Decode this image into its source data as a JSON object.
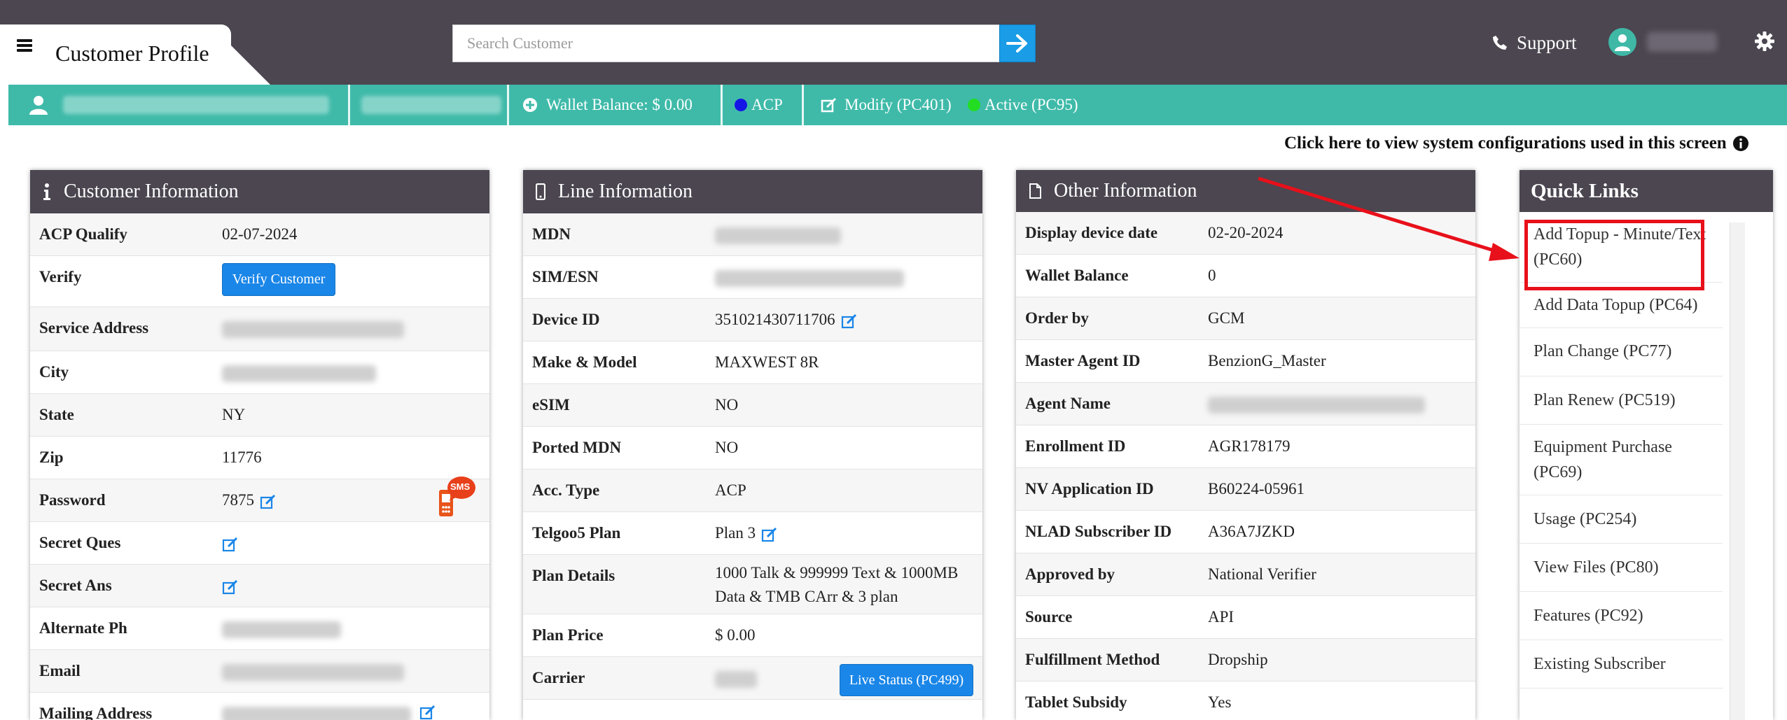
{
  "header": {
    "title": "Customer Profile",
    "search_placeholder": "Search Customer",
    "support_label": "Support"
  },
  "status_bar": {
    "wallet": "Wallet Balance: $ 0.00",
    "program": "ACP",
    "modify": "Modify (PC401)",
    "active": "Active (PC95)",
    "colors": {
      "program_dot": "#1515e6",
      "active_dot": "#22dd22"
    }
  },
  "config_link": "Click here to view system configurations used in this screen",
  "customer_info": {
    "title": "Customer Information",
    "verify_button": "Verify Customer",
    "rows": [
      {
        "label": "ACP Qualify",
        "value": "02-07-2024"
      },
      {
        "label": "Verify",
        "value": ""
      },
      {
        "label": "Service Address",
        "value": ""
      },
      {
        "label": "City",
        "value": ""
      },
      {
        "label": "State",
        "value": "NY"
      },
      {
        "label": "Zip",
        "value": "11776"
      },
      {
        "label": "Password",
        "value": "7875"
      },
      {
        "label": "Secret Ques",
        "value": ""
      },
      {
        "label": "Secret Ans",
        "value": ""
      },
      {
        "label": "Alternate Ph",
        "value": ""
      },
      {
        "label": "Email",
        "value": ""
      },
      {
        "label": "Mailing Address",
        "value": ""
      }
    ],
    "sms_badge": "SMS"
  },
  "line_info": {
    "title": "Line Information",
    "live_status_button": "Live Status (PC499)",
    "rows": [
      {
        "label": "MDN",
        "value": ""
      },
      {
        "label": "SIM/ESN",
        "value": ""
      },
      {
        "label": "Device ID",
        "value": "351021430711706"
      },
      {
        "label": "Make & Model",
        "value": "MAXWEST 8R"
      },
      {
        "label": "eSIM",
        "value": "NO"
      },
      {
        "label": "Ported MDN",
        "value": "NO"
      },
      {
        "label": "Acc. Type",
        "value": "ACP"
      },
      {
        "label": "Telgoo5 Plan",
        "value": "Plan 3"
      },
      {
        "label": "Plan Details",
        "value": "1000 Talk & 999999 Text & 1000MB",
        "value2": "Data & TMB CArr & 3 plan"
      },
      {
        "label": "Plan Price",
        "value": "$ 0.00"
      },
      {
        "label": "Carrier",
        "value": ""
      }
    ]
  },
  "other_info": {
    "title": "Other Information",
    "rows": [
      {
        "label": "Display device date",
        "value": "02-20-2024"
      },
      {
        "label": "Wallet Balance",
        "value": "0"
      },
      {
        "label": "Order by",
        "value": "GCM"
      },
      {
        "label": "Master Agent ID",
        "value": "BenzionG_Master"
      },
      {
        "label": "Agent Name",
        "value": ""
      },
      {
        "label": "Enrollment ID",
        "value": "AGR178179"
      },
      {
        "label": "NV Application ID",
        "value": "B60224-05961"
      },
      {
        "label": "NLAD Subscriber ID",
        "value": "A36A7JZKD"
      },
      {
        "label": "Approved by",
        "value": "National Verifier"
      },
      {
        "label": "Source",
        "value": "API"
      },
      {
        "label": "Fulfillment Method",
        "value": "Dropship"
      },
      {
        "label": "Tablet Subsidy",
        "value": "Yes"
      }
    ]
  },
  "quick_links": {
    "title": "Quick Links",
    "items": [
      "Add Topup - Minute/Text (PC60)",
      "Add Data Topup (PC64)",
      "Plan Change (PC77)",
      "Plan Renew (PC519)",
      "Equipment Purchase (PC69)",
      "Usage (PC254)",
      "View Files (PC80)",
      "Features (PC92)",
      "Existing Subscriber"
    ]
  },
  "annotation": {
    "color": "#e8101a"
  }
}
